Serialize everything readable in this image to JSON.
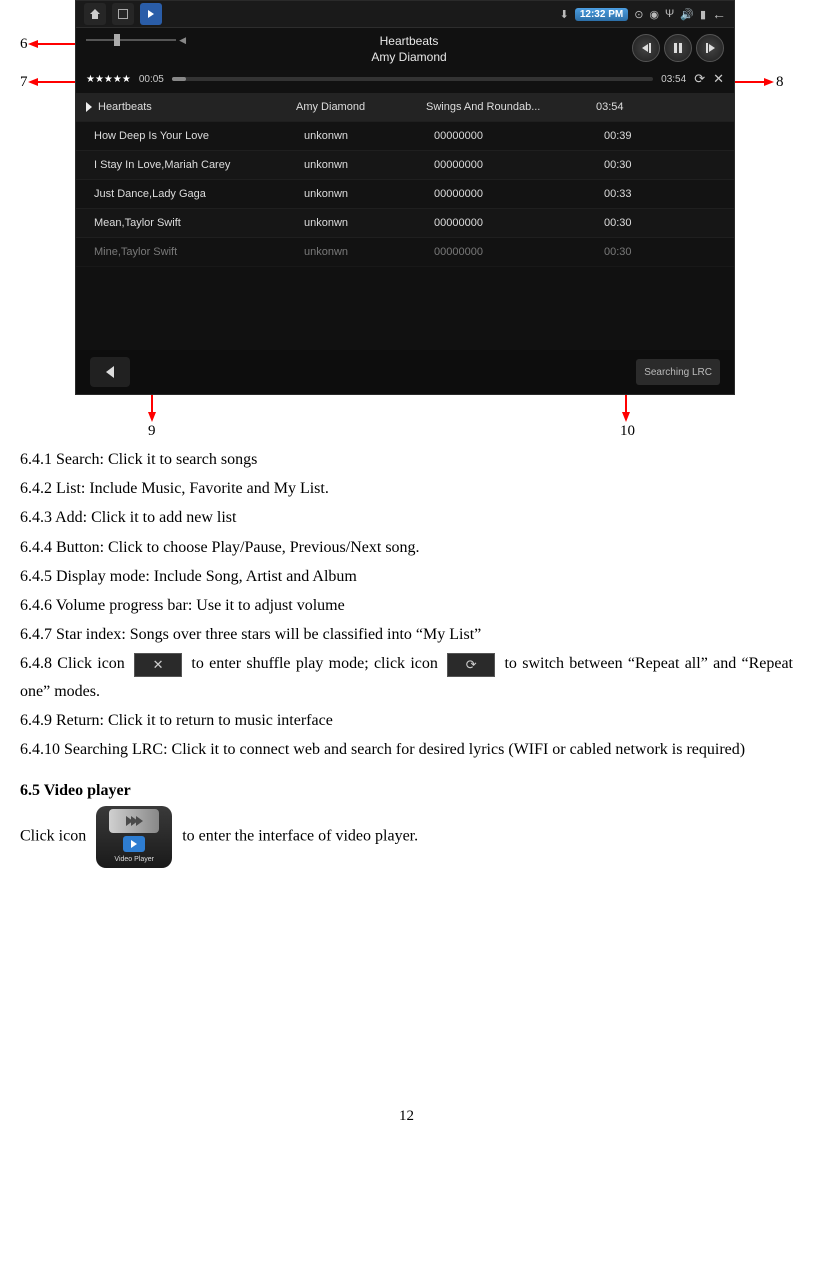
{
  "page_number": "12",
  "annotations": {
    "n6": "6",
    "n7": "7",
    "n8": "8",
    "n9": "9",
    "n10": "10"
  },
  "statusbar": {
    "time": "12:32 PM"
  },
  "now_playing": {
    "title": "Heartbeats",
    "artist": "Amy Diamond"
  },
  "progress": {
    "stars": "★★★★★",
    "elapsed": "00:05",
    "total": "03:54"
  },
  "playlist": [
    {
      "title": "Heartbeats",
      "artist": "Amy Diamond",
      "album": "Swings And Roundab...",
      "dur": "03:54",
      "playing": true
    },
    {
      "title": "How Deep Is Your Love",
      "artist": "unkonwn",
      "album": "00000000",
      "dur": "00:39"
    },
    {
      "title": "I Stay In Love,Mariah Carey",
      "artist": "unkonwn",
      "album": "00000000",
      "dur": "00:30"
    },
    {
      "title": "Just Dance,Lady Gaga",
      "artist": "unkonwn",
      "album": "00000000",
      "dur": "00:33"
    },
    {
      "title": "Mean,Taylor Swift",
      "artist": "unkonwn",
      "album": "00000000",
      "dur": "00:30"
    },
    {
      "title": "Mine,Taylor Swift",
      "artist": "unkonwn",
      "album": "00000000",
      "dur": "00:30"
    }
  ],
  "bottom": {
    "lrc": "Searching LRC"
  },
  "doc": {
    "l1": "6.4.1 Search: Click it to search songs",
    "l2": "6.4.2 List: Include Music, Favorite and My List.",
    "l3": "6.4.3 Add: Click it to add new list",
    "l4": "6.4.4 Button: Click to choose Play/Pause, Previous/Next song.",
    "l5": "6.4.5 Display mode: Include Song, Artist and Album",
    "l6": "6.4.6 Volume progress bar: Use it to adjust volume",
    "l7": "6.4.7 Star index: Songs over three stars will be classified into “My List”",
    "l8a": "6.4.8 Click icon ",
    "l8b": " to enter shuffle play mode; click icon ",
    "l8c": " to switch between “Repeat all” and “Repeat one” modes.",
    "l9": "6.4.9 Return: Click it to return to music interface",
    "l10": "6.4.10 Searching LRC: Click it to connect web and search for desired lyrics (WIFI or cabled network is required)",
    "h65": "6.5 Video player",
    "v1": "Click icon ",
    "v2": " to enter the interface of video player.",
    "video_label": "Video Player"
  }
}
